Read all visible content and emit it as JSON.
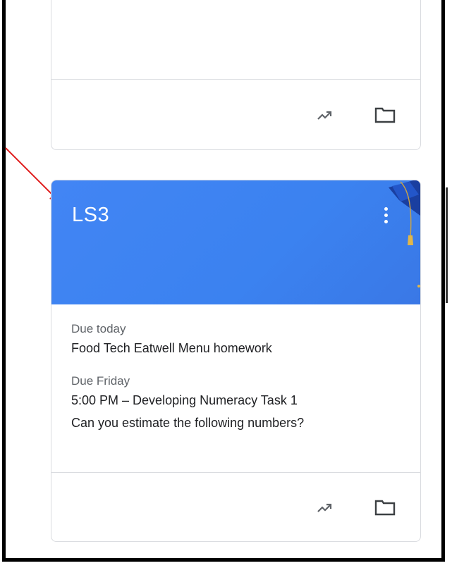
{
  "top_card": {
    "icons": {
      "trend": "trending-up-icon",
      "folder": "folder-icon"
    }
  },
  "class_card": {
    "title": "LS3",
    "banner_color": "#4285f4",
    "menu_icon": "more-vert-icon",
    "due_groups": [
      {
        "label": "Due today",
        "items": [
          "Food Tech Eatwell Menu homework"
        ]
      },
      {
        "label": "Due Friday",
        "items": [
          "5:00 PM – Developing Numeracy Task 1",
          "Can you estimate the following numbers?"
        ]
      }
    ],
    "icons": {
      "trend": "trending-up-icon",
      "folder": "folder-icon"
    }
  },
  "annotation": {
    "arrow_color": "#e02020"
  }
}
